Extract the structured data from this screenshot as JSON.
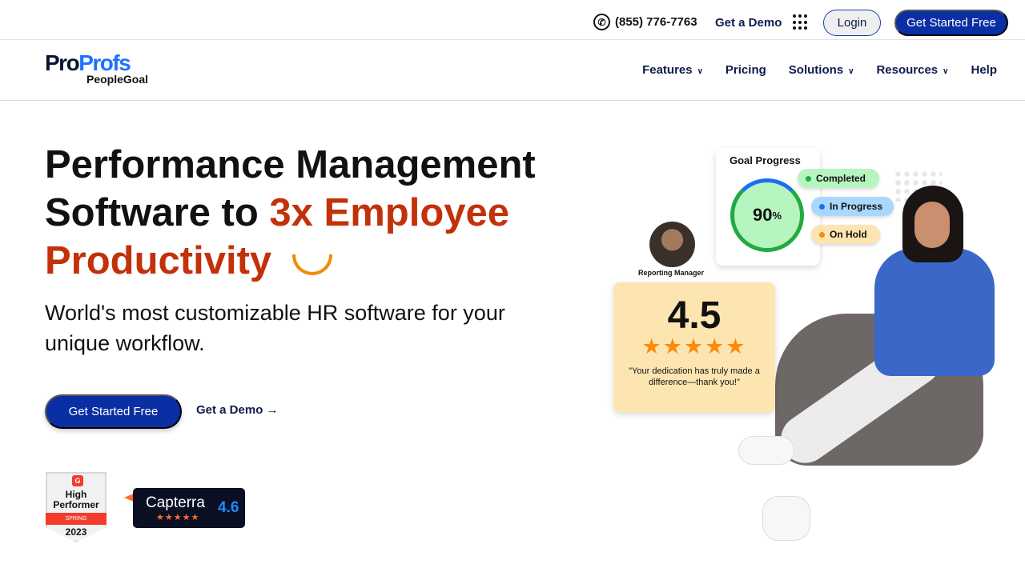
{
  "topbar": {
    "phone": "(855) 776-7763",
    "demo": "Get a Demo",
    "login": "Login",
    "get_started": "Get Started Free"
  },
  "logo": {
    "pro": "Pro",
    "profs": "Profs",
    "product": "PeopleGoal"
  },
  "nav": [
    {
      "label": "Features",
      "dropdown": true
    },
    {
      "label": "Pricing",
      "dropdown": false
    },
    {
      "label": "Solutions",
      "dropdown": true
    },
    {
      "label": "Resources",
      "dropdown": true
    },
    {
      "label": "Help",
      "dropdown": false
    }
  ],
  "hero": {
    "line1": "Performance Management",
    "line2a": "Software to ",
    "line2b": "3x Employee",
    "line3": "Productivity",
    "subtitle": "World's most customizable HR software for your unique workflow.",
    "cta": "Get Started Free",
    "demo": "Get a Demo →"
  },
  "badges": {
    "g2": {
      "logo": "G",
      "title1": "High",
      "title2": "Performer",
      "season": "SPRING",
      "year": "2023"
    },
    "capterra": {
      "name": "Capterra",
      "stars": "★★★★★",
      "score": "4.6"
    }
  },
  "illustration": {
    "goal_title": "Goal Progress",
    "goal_percent": "90",
    "goal_unit": "%",
    "statuses": [
      "Completed",
      "In Progress",
      "On Hold"
    ],
    "manager_label": "Reporting Manager",
    "rating": "4.5",
    "rating_stars": "★★★★★",
    "quote": "\"Your dedication has truly made a difference—thank you!\""
  }
}
